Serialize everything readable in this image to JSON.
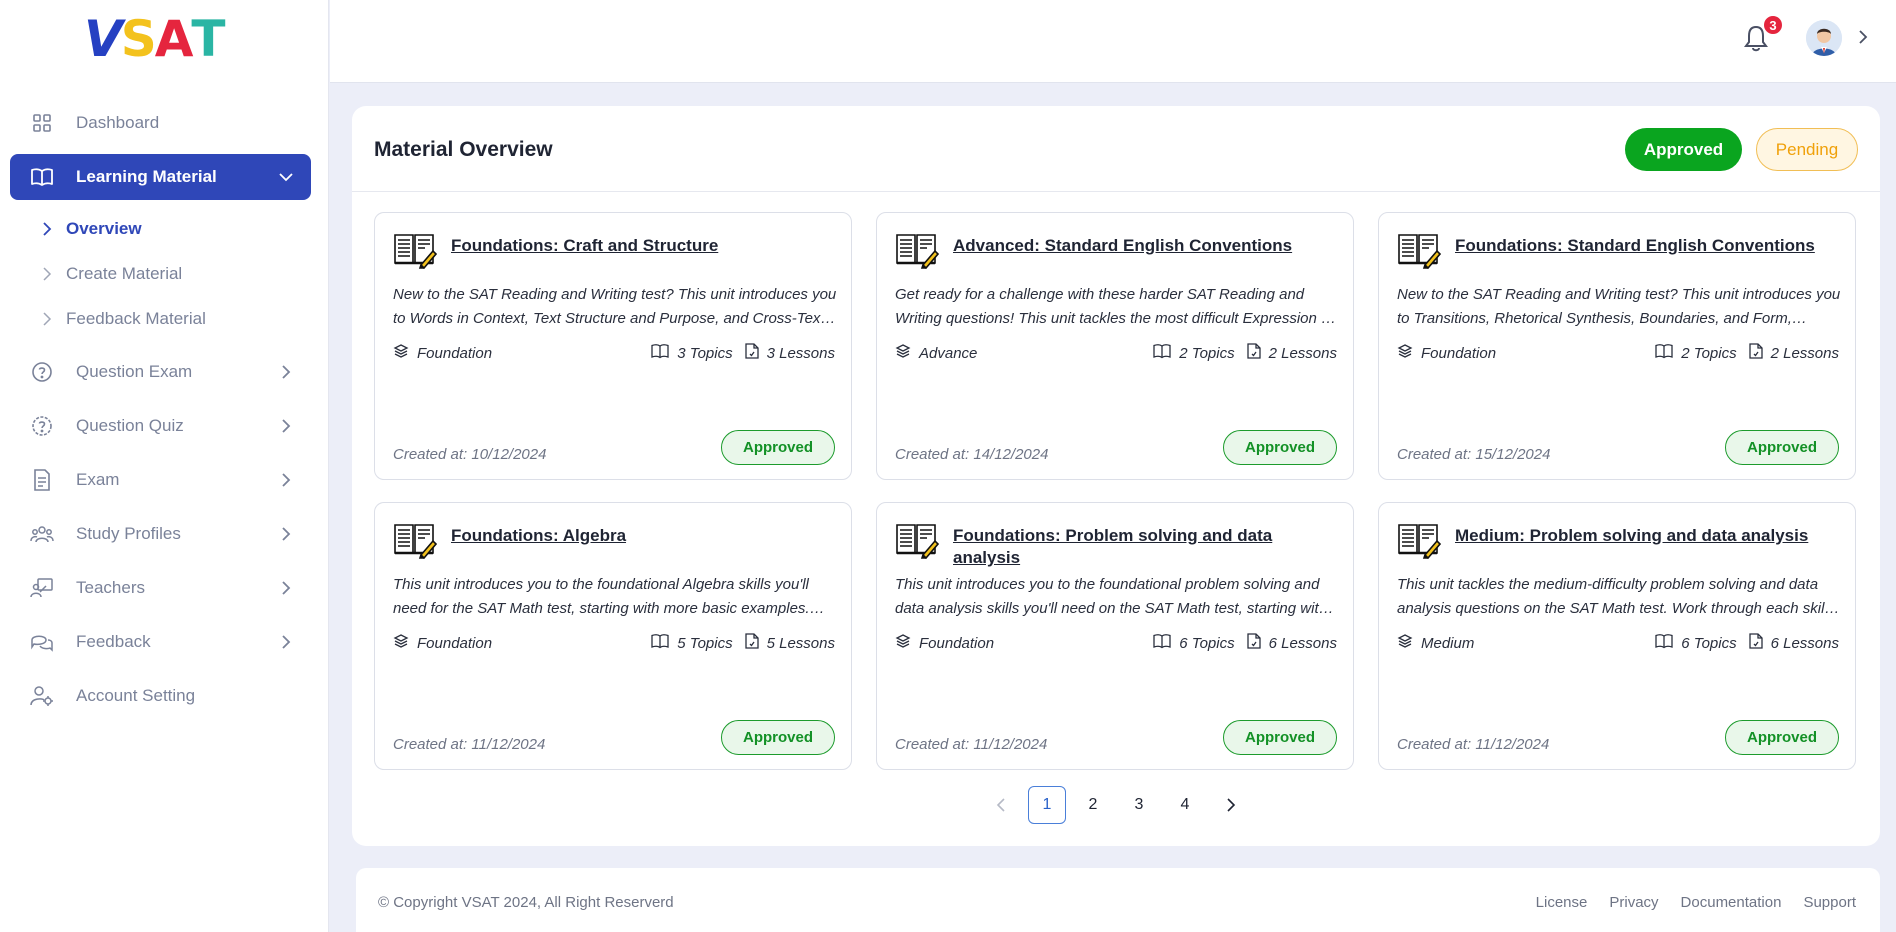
{
  "brand": {
    "letters": [
      {
        "ch": "V",
        "color": "#2540c2"
      },
      {
        "ch": "S",
        "color": "#f3c21d"
      },
      {
        "ch": "A",
        "color": "#e5253e"
      },
      {
        "ch": "T",
        "color": "#2ab5a4"
      }
    ]
  },
  "sidebar": {
    "items": [
      {
        "label": "Dashboard",
        "icon": "grid-icon"
      },
      {
        "label": "Learning Material",
        "icon": "book-icon",
        "active": true
      },
      {
        "label": "Question Exam",
        "icon": "question-circle-icon"
      },
      {
        "label": "Question Quiz",
        "icon": "question-gear-icon"
      },
      {
        "label": "Exam",
        "icon": "document-icon"
      },
      {
        "label": "Study Profiles",
        "icon": "users-icon"
      },
      {
        "label": "Teachers",
        "icon": "teacher-icon"
      },
      {
        "label": "Feedback",
        "icon": "chat-icon"
      },
      {
        "label": "Account Setting",
        "icon": "user-gear-icon"
      }
    ],
    "submenu": [
      {
        "label": "Overview"
      },
      {
        "label": "Create Material"
      },
      {
        "label": "Feedback Material"
      }
    ]
  },
  "topbar": {
    "notification_count": "3"
  },
  "main": {
    "title": "Material Overview",
    "filters": {
      "approved": "Approved",
      "pending": "Pending"
    },
    "cards": [
      {
        "title": "Foundations: Craft and Structure",
        "description": "New to the SAT Reading and Writing test? This unit introduces you to Words in Context, Text Structure and Purpose, and Cross-Text Connections.",
        "level": "Foundation",
        "topics": "3 Topics",
        "lessons": "3 Lessons",
        "created": "Created at: 10/12/2024",
        "status": "Approved"
      },
      {
        "title": "Advanced: Standard English Conventions",
        "description": "Get ready for a challenge with these harder SAT Reading and Writing questions! This unit tackles the most difficult Expression of Ideas questions.",
        "level": "Advance",
        "topics": "2 Topics",
        "lessons": "2 Lessons",
        "created": "Created at: 14/12/2024",
        "status": "Approved"
      },
      {
        "title": "Foundations: Standard English Conventions",
        "description": "New to the SAT Reading and Writing test? This unit introduces you to Transitions, Rhetorical Synthesis, Boundaries, and Form, Structure, and Sense.",
        "level": "Foundation",
        "topics": "2 Topics",
        "lessons": "2 Lessons",
        "created": "Created at: 15/12/2024",
        "status": "Approved"
      },
      {
        "title": "Foundations: Algebra",
        "description": "This unit introduces you to the foundational Algebra skills you'll need for the SAT Math test, starting with more basic examples. Work through each skill.",
        "level": "Foundation",
        "topics": "5 Topics",
        "lessons": "5 Lessons",
        "created": "Created at: 11/12/2024",
        "status": "Approved"
      },
      {
        "title": "Foundations: Problem solving and data analysis",
        "description": "This unit introduces you to the foundational problem solving and data analysis skills you'll need on the SAT Math test, starting with basic examples.",
        "level": "Foundation",
        "topics": "6 Topics",
        "lessons": "6 Lessons",
        "created": "Created at: 11/12/2024",
        "status": "Approved"
      },
      {
        "title": "Medium: Problem solving and data analysis",
        "description": "This unit tackles the medium-difficulty problem solving and data analysis questions on the SAT Math test. Work through each skill, taking quizzes.",
        "level": "Medium",
        "topics": "6 Topics",
        "lessons": "6 Lessons",
        "created": "Created at: 11/12/2024",
        "status": "Approved"
      }
    ],
    "pagination": {
      "pages": [
        "1",
        "2",
        "3",
        "4"
      ],
      "current": "1"
    }
  },
  "footer": {
    "copyright": "© Copyright VSAT 2024, All Right Reserverd",
    "links": [
      "License",
      "Privacy",
      "Documentation",
      "Support"
    ]
  },
  "colors": {
    "primary": "#2f47b8",
    "approved": "#0aa51f",
    "pending": "#f0a10a",
    "badge": "#e5253e"
  }
}
